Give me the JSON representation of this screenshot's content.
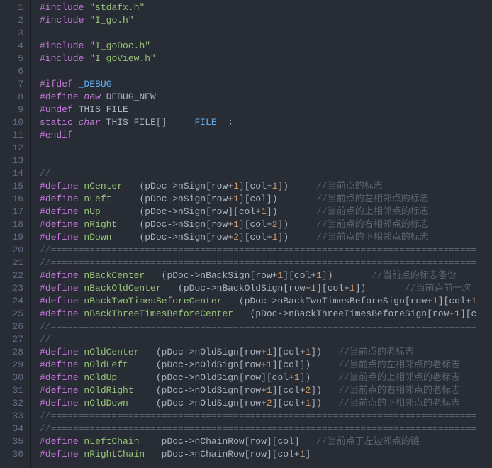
{
  "theme": {
    "background": "#282c34",
    "gutter_fg": "#636d83",
    "foreground": "#abb2bf",
    "keyword": "#c678dd",
    "string": "#98c379",
    "number": "#d19a66",
    "comment": "#5c6370",
    "green_ident": "#98c379",
    "macro_name": "#61afef"
  },
  "lines": [
    {
      "n": "1",
      "tokens": [
        [
          "pre",
          "#include"
        ],
        [
          "sp",
          " "
        ],
        [
          "str",
          "\"stdafx.h\""
        ]
      ]
    },
    {
      "n": "2",
      "tokens": [
        [
          "pre",
          "#include"
        ],
        [
          "sp",
          " "
        ],
        [
          "str",
          "\"I_go.h\""
        ]
      ]
    },
    {
      "n": "3",
      "tokens": []
    },
    {
      "n": "4",
      "tokens": [
        [
          "pre",
          "#include"
        ],
        [
          "sp",
          " "
        ],
        [
          "str",
          "\"I_goDoc.h\""
        ]
      ]
    },
    {
      "n": "5",
      "tokens": [
        [
          "pre",
          "#include"
        ],
        [
          "sp",
          " "
        ],
        [
          "str",
          "\"I_goView.h\""
        ]
      ]
    },
    {
      "n": "6",
      "tokens": []
    },
    {
      "n": "7",
      "tokens": [
        [
          "pre",
          "#ifdef"
        ],
        [
          "sp",
          " "
        ],
        [
          "macro",
          "_DEBUG"
        ]
      ]
    },
    {
      "n": "8",
      "tokens": [
        [
          "pre",
          "#define"
        ],
        [
          "sp",
          " "
        ],
        [
          "key2",
          "new"
        ],
        [
          "sp",
          " "
        ],
        [
          "id",
          "DEBUG_NEW"
        ]
      ]
    },
    {
      "n": "9",
      "tokens": [
        [
          "pre",
          "#undef"
        ],
        [
          "sp",
          " "
        ],
        [
          "id",
          "THIS_FILE"
        ]
      ]
    },
    {
      "n": "10",
      "tokens": [
        [
          "key",
          "static"
        ],
        [
          "sp",
          " "
        ],
        [
          "type",
          "char"
        ],
        [
          "sp",
          " "
        ],
        [
          "id",
          "THIS_FILE[] = "
        ],
        [
          "macro",
          "__FILE__"
        ],
        [
          "id",
          ";"
        ]
      ]
    },
    {
      "n": "11",
      "tokens": [
        [
          "pre",
          "#endif"
        ]
      ]
    },
    {
      "n": "12",
      "tokens": []
    },
    {
      "n": "13",
      "tokens": []
    },
    {
      "n": "14",
      "tokens": [
        [
          "cmt",
          "//============================================================================="
        ]
      ]
    },
    {
      "n": "15",
      "tokens": [
        [
          "pre",
          "#define"
        ],
        [
          "sp",
          " "
        ],
        [
          "grn",
          "nCenter"
        ],
        [
          "sp",
          "   "
        ],
        [
          "id",
          "(pDoc->nSign[row+"
        ],
        [
          "num",
          "1"
        ],
        [
          "id",
          "][col+"
        ],
        [
          "num",
          "1"
        ],
        [
          "id",
          "])     "
        ],
        [
          "cmt",
          "//当前点的标志"
        ]
      ]
    },
    {
      "n": "16",
      "tokens": [
        [
          "pre",
          "#define"
        ],
        [
          "sp",
          " "
        ],
        [
          "grn",
          "nLeft"
        ],
        [
          "sp",
          "     "
        ],
        [
          "id",
          "(pDoc->nSign[row+"
        ],
        [
          "num",
          "1"
        ],
        [
          "id",
          "][col])       "
        ],
        [
          "cmt",
          "//当前点的左相邻点的标志"
        ]
      ]
    },
    {
      "n": "17",
      "tokens": [
        [
          "pre",
          "#define"
        ],
        [
          "sp",
          " "
        ],
        [
          "grn",
          "nUp"
        ],
        [
          "sp",
          "       "
        ],
        [
          "id",
          "(pDoc->nSign[row][col+"
        ],
        [
          "num",
          "1"
        ],
        [
          "id",
          "])       "
        ],
        [
          "cmt",
          "//当前点的上相邻点的标志"
        ]
      ]
    },
    {
      "n": "18",
      "tokens": [
        [
          "pre",
          "#define"
        ],
        [
          "sp",
          " "
        ],
        [
          "grn",
          "nRight"
        ],
        [
          "sp",
          "    "
        ],
        [
          "id",
          "(pDoc->nSign[row+"
        ],
        [
          "num",
          "1"
        ],
        [
          "id",
          "][col+"
        ],
        [
          "num",
          "2"
        ],
        [
          "id",
          "])     "
        ],
        [
          "cmt",
          "//当前点的右相邻点的标志"
        ]
      ]
    },
    {
      "n": "19",
      "tokens": [
        [
          "pre",
          "#define"
        ],
        [
          "sp",
          " "
        ],
        [
          "grn",
          "nDown"
        ],
        [
          "sp",
          "     "
        ],
        [
          "id",
          "(pDoc->nSign[row+"
        ],
        [
          "num",
          "2"
        ],
        [
          "id",
          "][col+"
        ],
        [
          "num",
          "1"
        ],
        [
          "id",
          "])     "
        ],
        [
          "cmt",
          "//当前点的下相邻点的标志"
        ]
      ]
    },
    {
      "n": "20",
      "tokens": [
        [
          "cmt",
          "//============================================================================="
        ]
      ]
    },
    {
      "n": "21",
      "tokens": [
        [
          "cmt",
          "//============================================================================="
        ]
      ]
    },
    {
      "n": "22",
      "tokens": [
        [
          "pre",
          "#define"
        ],
        [
          "sp",
          " "
        ],
        [
          "grn",
          "nBackCenter"
        ],
        [
          "sp",
          "   "
        ],
        [
          "id",
          "(pDoc->nBackSign[row+"
        ],
        [
          "num",
          "1"
        ],
        [
          "id",
          "][col+"
        ],
        [
          "num",
          "1"
        ],
        [
          "id",
          "])       "
        ],
        [
          "cmt",
          "//当前点的标志备份"
        ]
      ]
    },
    {
      "n": "23",
      "tokens": [
        [
          "pre",
          "#define"
        ],
        [
          "sp",
          " "
        ],
        [
          "grn",
          "nBackOldCenter"
        ],
        [
          "sp",
          "   "
        ],
        [
          "id",
          "(pDoc->nBackOldSign[row+"
        ],
        [
          "num",
          "1"
        ],
        [
          "id",
          "][col+"
        ],
        [
          "num",
          "1"
        ],
        [
          "id",
          "])       "
        ],
        [
          "cmt",
          "//当前点前一次"
        ]
      ]
    },
    {
      "n": "24",
      "tokens": [
        [
          "pre",
          "#define"
        ],
        [
          "sp",
          " "
        ],
        [
          "grn",
          "nBackTwoTimesBeforeCenter"
        ],
        [
          "sp",
          "   "
        ],
        [
          "id",
          "(pDoc->nBackTwoTimesBeforeSign[row+"
        ],
        [
          "num",
          "1"
        ],
        [
          "id",
          "][col+"
        ],
        [
          "num",
          "1"
        ]
      ]
    },
    {
      "n": "25",
      "tokens": [
        [
          "pre",
          "#define"
        ],
        [
          "sp",
          " "
        ],
        [
          "grn",
          "nBackThreeTimesBeforeCenter"
        ],
        [
          "sp",
          "   "
        ],
        [
          "id",
          "(pDoc->nBackThreeTimesBeforeSign[row+"
        ],
        [
          "num",
          "1"
        ],
        [
          "id",
          "][c"
        ]
      ]
    },
    {
      "n": "26",
      "tokens": [
        [
          "cmt",
          "//============================================================================="
        ]
      ]
    },
    {
      "n": "27",
      "tokens": [
        [
          "cmt",
          "//============================================================================="
        ]
      ]
    },
    {
      "n": "28",
      "tokens": [
        [
          "pre",
          "#define"
        ],
        [
          "sp",
          " "
        ],
        [
          "grn",
          "nOldCenter"
        ],
        [
          "sp",
          "   "
        ],
        [
          "id",
          "(pDoc->nOldSign[row+"
        ],
        [
          "num",
          "1"
        ],
        [
          "id",
          "][col+"
        ],
        [
          "num",
          "1"
        ],
        [
          "id",
          "])   "
        ],
        [
          "cmt",
          "//当前点的老标志"
        ]
      ]
    },
    {
      "n": "29",
      "tokens": [
        [
          "pre",
          "#define"
        ],
        [
          "sp",
          " "
        ],
        [
          "grn",
          "nOldLeft"
        ],
        [
          "sp",
          "     "
        ],
        [
          "id",
          "(pDoc->nOldSign[row+"
        ],
        [
          "num",
          "1"
        ],
        [
          "id",
          "][col])     "
        ],
        [
          "cmt",
          "//当前点的左相邻点的老标志"
        ]
      ]
    },
    {
      "n": "30",
      "tokens": [
        [
          "pre",
          "#define"
        ],
        [
          "sp",
          " "
        ],
        [
          "grn",
          "nOldUp"
        ],
        [
          "sp",
          "       "
        ],
        [
          "id",
          "(pDoc->nOldSign[row][col+"
        ],
        [
          "num",
          "1"
        ],
        [
          "id",
          "])     "
        ],
        [
          "cmt",
          "//当前点的上相邻点的老标志"
        ]
      ]
    },
    {
      "n": "31",
      "tokens": [
        [
          "pre",
          "#define"
        ],
        [
          "sp",
          " "
        ],
        [
          "grn",
          "nOldRight"
        ],
        [
          "sp",
          "    "
        ],
        [
          "id",
          "(pDoc->nOldSign[row+"
        ],
        [
          "num",
          "1"
        ],
        [
          "id",
          "][col+"
        ],
        [
          "num",
          "2"
        ],
        [
          "id",
          "])   "
        ],
        [
          "cmt",
          "//当前点的右相邻点的老标志"
        ]
      ]
    },
    {
      "n": "32",
      "tokens": [
        [
          "pre",
          "#define"
        ],
        [
          "sp",
          " "
        ],
        [
          "grn",
          "nOldDown"
        ],
        [
          "sp",
          "     "
        ],
        [
          "id",
          "(pDoc->nOldSign[row+"
        ],
        [
          "num",
          "2"
        ],
        [
          "id",
          "][col+"
        ],
        [
          "num",
          "1"
        ],
        [
          "id",
          "])   "
        ],
        [
          "cmt",
          "//当前点的下相邻点的老标志"
        ]
      ]
    },
    {
      "n": "33",
      "tokens": [
        [
          "cmt",
          "//============================================================================="
        ]
      ]
    },
    {
      "n": "34",
      "tokens": [
        [
          "cmt",
          "//============================================================================="
        ]
      ]
    },
    {
      "n": "35",
      "tokens": [
        [
          "pre",
          "#define"
        ],
        [
          "sp",
          " "
        ],
        [
          "grn",
          "nLeftChain"
        ],
        [
          "sp",
          "    "
        ],
        [
          "id",
          "pDoc->nChainRow[row][col]   "
        ],
        [
          "cmt",
          "//当前点于左边邻点的链"
        ]
      ]
    },
    {
      "n": "36",
      "tokens": [
        [
          "pre",
          "#define"
        ],
        [
          "sp",
          " "
        ],
        [
          "grn",
          "nRightChain"
        ],
        [
          "sp",
          "   "
        ],
        [
          "id",
          "pDoc->nChainRow[row][col+"
        ],
        [
          "num",
          "1"
        ],
        [
          "id",
          "]"
        ]
      ]
    }
  ]
}
